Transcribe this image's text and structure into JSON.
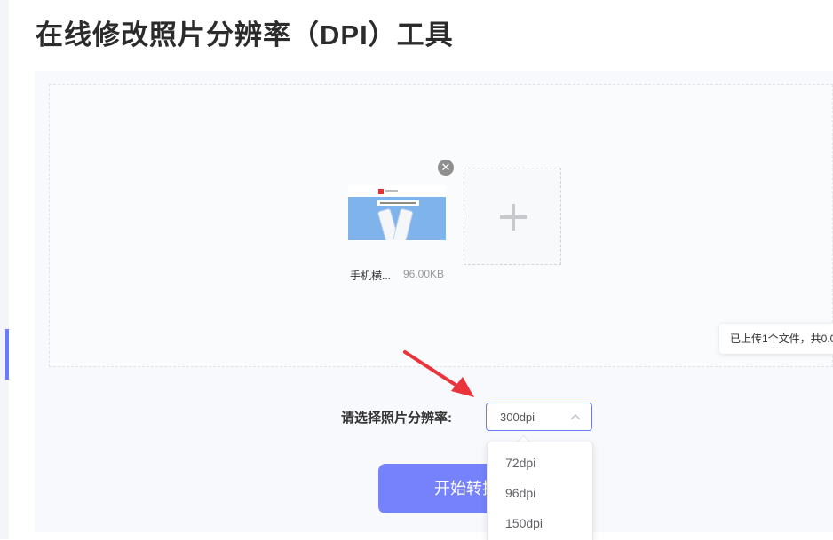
{
  "page": {
    "title": "在线修改照片分辨率（DPI）工具"
  },
  "upload": {
    "file": {
      "name": "手机横...",
      "size": "96.00KB"
    },
    "remove_icon": "close-circle-icon",
    "add_icon": "plus-icon",
    "tip": "已上传1个文件，共0.0"
  },
  "form": {
    "dpi_label": "请选择照片分辨率:",
    "dpi_selected": "300dpi",
    "dpi_options": [
      "72dpi",
      "96dpi",
      "150dpi"
    ],
    "start_button": "开始转换"
  },
  "colors": {
    "accent": "#6a7bff",
    "button": "#7582fb",
    "arrow": "#e8343a"
  }
}
